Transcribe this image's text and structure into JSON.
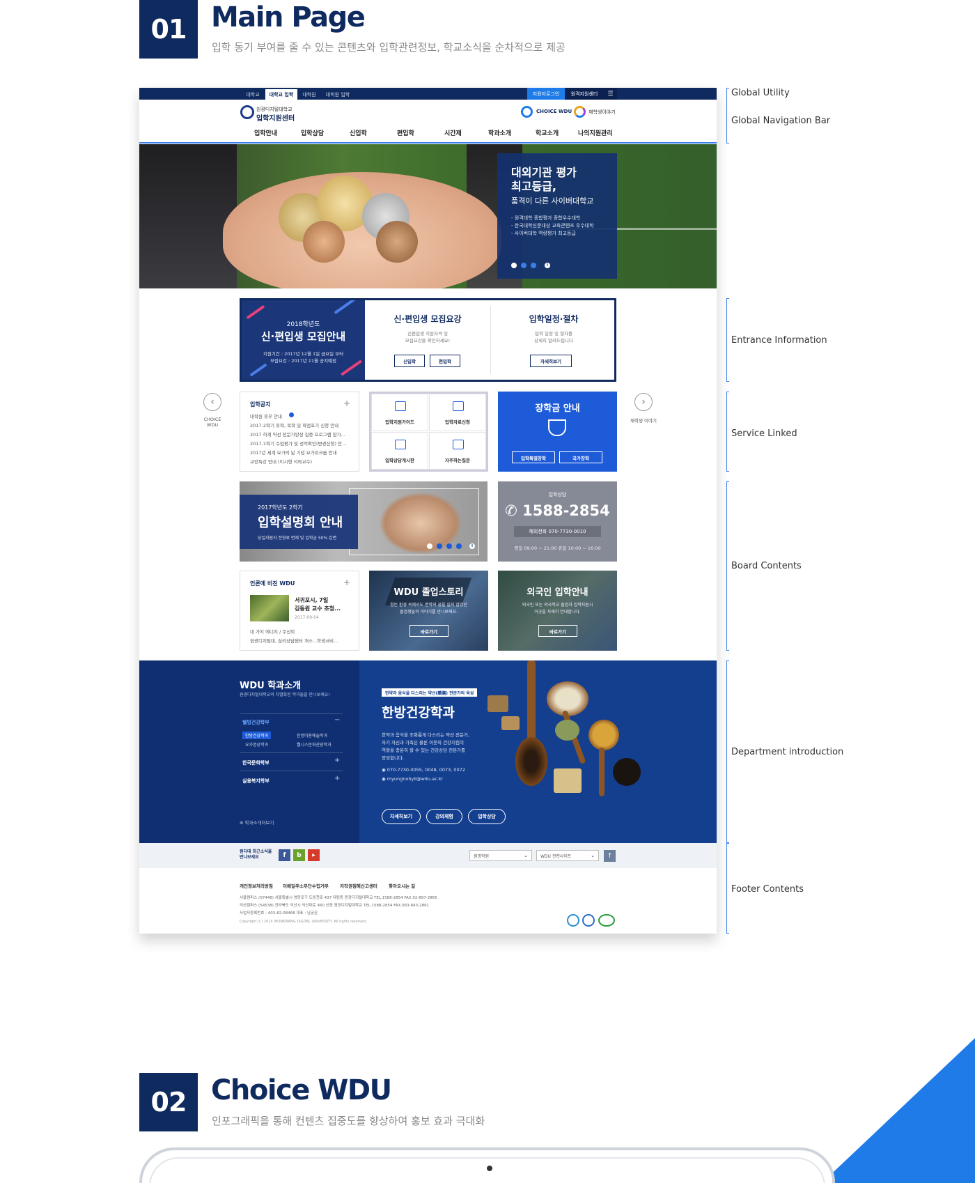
{
  "section1": {
    "num": "01",
    "title": "Main Page",
    "subtitle": "입학 동기 부여를 줄 수 있는 콘텐츠와 입학관련정보, 학교소식을 순차적으로 제공"
  },
  "section2": {
    "num": "02",
    "title": "Choice WDU",
    "subtitle": "인포그래픽을 통해 컨텐츠 집중도를 향상하여  홍보 효과 극대화"
  },
  "annotations": [
    "Global Utility",
    "Global Navigation Bar",
    "Entrance Information",
    "Service Linked",
    "Board Contents",
    "Department introduction",
    "Footer Contents"
  ],
  "utility": {
    "tabs": [
      "대학교",
      "대학교 입학",
      "대학원",
      "대학원 입학"
    ],
    "active_tab": 1,
    "login": "지원자로그인",
    "center": "원격지원센터",
    "menu_icon": "hamburger-icon"
  },
  "logo": {
    "line1": "원광디지털대학교",
    "line2": "입학지원센터",
    "choice": "CHOICE WDU",
    "story": "재학생이야기"
  },
  "gnb": [
    "입학안내",
    "입학상담",
    "신입학",
    "편입학",
    "시간제",
    "학과소개",
    "학교소개",
    "나의지원관리"
  ],
  "hero": {
    "title_line1": "대외기관 평가",
    "title_line2": "최고등급,",
    "subtitle": "품격이 다른 사이버대학교",
    "bullets": [
      "- 원격대학 종합평가 종합우수대학",
      "- 한국대학신문대상 교육콘텐츠 우수대학",
      "- 사이버대학 역량평가 최고등급"
    ],
    "pause_icon": "pause-icon"
  },
  "entrance": {
    "year": "2018학년도",
    "title": "신·편입생 모집안내",
    "desc1": "지원기간 : 2017년 12월 1일 금요일 부터",
    "desc2": "모집요강 : 2017년 11월 공지예정",
    "col1": {
      "title": "신·편입생 모집요강",
      "desc1": "신편입생 지원자격 및",
      "desc2": "모집요강을 확인하세요!",
      "btn1": "신입학",
      "btn2": "편입학"
    },
    "col2": {
      "title": "입학일정·절차",
      "desc1": "입학 일정 및 절차를",
      "desc2": "상세히 알려드립니다",
      "btn": "자세히보기"
    }
  },
  "side": {
    "left": "CHOICE WDU",
    "right": "재학생 이야기"
  },
  "notice": {
    "title": "입학공지",
    "items": [
      "대학원 휴무 안내",
      "2017-2학기 휴학, 복학 및 학점포기 신청 안내",
      "2017 하계 약선 전문가양성 집중 프로그램 참가...",
      "2017-1학기 수업평가 및 성적확인(변경신청) 안...",
      "2017년 세계 요가의 날 기념 요가위크숍 안내",
      "교양특강 안내 (이시형 석좌교수)"
    ]
  },
  "services": [
    "입학지원가이드",
    "입학자료신청",
    "입학상담게시판",
    "자주하는질문"
  ],
  "scholarship": {
    "title": "장학금 안내",
    "btn1": "입학특별장학",
    "btn2": "국가장학"
  },
  "briefing": {
    "year": "2017학년도 2학기",
    "title": "입학설명회 안내",
    "desc": "당일지원자 전형료 면제 및 입학금 50% 감면"
  },
  "consult": {
    "label": "입학상담",
    "phone": "1588-2854",
    "overseas": "해외전화 070-7730-0010",
    "hours": "평일 09:00 ~ 21:00    휴일 10:00 ~ 16:00"
  },
  "press": {
    "title": "언론에 비친 WDU",
    "headline1": "서귀포시, 7일",
    "headline2": "김동원 교수 초청...",
    "date": "2017-09-04",
    "line1": "네 가지 에너지 / 주선희",
    "line2": "원광디지털대, 심리상담센터 개소...학생서비..."
  },
  "story": {
    "title": "WDU 졸업스토리",
    "desc1": "힘든 환경 속에서도 면학의 꿈을 잃지 않았던",
    "desc2": "졸업생들의 이야기를 만나보세요.",
    "btn": "바로가기"
  },
  "foreign": {
    "title": "외국인 입학안내",
    "desc1": "외국인 또는 외국학교 졸업자 입학지원시",
    "desc2": "이곳을 자세히 안내합니다.",
    "btn": "바로가기"
  },
  "department": {
    "title": "WDU 학과소개",
    "subtitle": "원광디지털대학교의 차별화된 학과들을 만나보세요!",
    "cat1": "웰빙건강학부",
    "subs": [
      "한방건강학과",
      "한방미용예술학과",
      "요가명상학과",
      "웰니스문화관광학과"
    ],
    "cat2": "한국문화학부",
    "cat3": "실용복지학부",
    "link": "학과소개더보기",
    "tag": "한약과 음식을 다스리는 약선(藥膳) 전문가의 육성",
    "name": "한방건강학과",
    "desc": [
      "한약과 음식을 조화롭게 다스리는 약선 전문가,",
      "자기 자신과 가족은 물론 이웃의 건강지킴이",
      "역할을 충분히 할 수 있는 건강상담 전문가를",
      "양성합니다."
    ],
    "phone": "070-7730-0055, 0048, 0073, 0072",
    "email": "myungnohyil@wdu.ac.kr",
    "btns": [
      "자세히보기",
      "강의체험",
      "입학상담"
    ]
  },
  "footer": {
    "sns_label1": "원디대 최근소식을",
    "sns_label2": "만나보세요",
    "select1": "원광학원",
    "select2": "WDU 관련사이트",
    "links": [
      "개인정보처리방침",
      "이메일주소무단수집거부",
      "저작권침해신고센터",
      "찾아오시는 길"
    ],
    "addr1": "서울캠퍼스  (07448) 서울특별시 영등포구 도림천로 437 대림동 원광디지털대학교      TEL.1588-2854      FAX.02-897-2865",
    "addr2": "익산캠퍼스  (54538) 전라북도 익산시 익산대로 460 신동 원광디지털대학교      TEL.1588-2854      FAX.063-843-2861",
    "addr3": "사업자등록번호 : 403-82-08468      대표 : 남궁문",
    "copyright": "Copyright (C) 2014 WONKWANG DIGITAL UNIVERSITY. All rights reserved."
  },
  "colors": {
    "navy": "#0f2a5f",
    "blue": "#1e5bd8",
    "accent": "#1e7be8"
  }
}
